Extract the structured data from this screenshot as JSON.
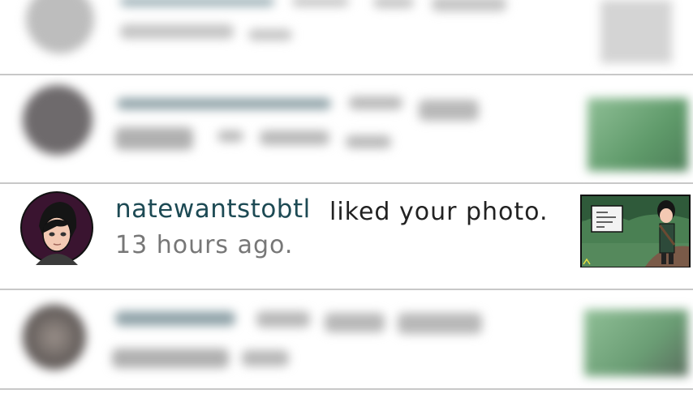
{
  "notification": {
    "username": "natewantstobtl",
    "action": "liked your photo.",
    "time": "13 hours ago."
  },
  "colors": {
    "username": "#1d4a54",
    "action": "#222222",
    "time": "#777777",
    "divider": "#c8c8c8"
  }
}
